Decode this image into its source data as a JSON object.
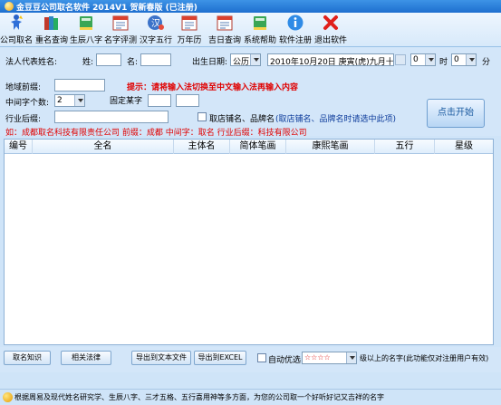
{
  "window": {
    "title": "金豆豆公司取名软件 2014V1 贺新春版 (已注册)"
  },
  "toolbar": [
    {
      "label": "公司取名",
      "icon": "figure-icon"
    },
    {
      "label": "重名查询",
      "icon": "books-icon"
    },
    {
      "label": "生辰八字",
      "icon": "book-icon"
    },
    {
      "label": "名字评测",
      "icon": "calendar-icon"
    },
    {
      "label": "汉字五行",
      "icon": "character-icon"
    },
    {
      "label": "万年历",
      "icon": "calendar-icon"
    },
    {
      "label": "吉日查询",
      "icon": "calendar-icon"
    },
    {
      "label": "系统帮助",
      "icon": "book-icon"
    },
    {
      "label": "软件注册",
      "icon": "info-icon"
    },
    {
      "label": "退出软件",
      "icon": "close-icon"
    }
  ],
  "form": {
    "legal_rep_label": "法人代表姓名:",
    "surname_label": "姓:",
    "name_label": "名:",
    "birth_label": "出生日期:",
    "calendar_type": "公历",
    "birth_date": "2010年10月20日 庚寅(虎)九月十三",
    "hour_value": "0",
    "hour_label": "时",
    "minute_value": "0",
    "minute_label": "分",
    "region_label": "地域前缀:",
    "hint": "提示：请将输入法切换至中文输入法再输入内容",
    "mid_count_label": "中间字个数:",
    "mid_count_value": "2",
    "fixed_char_label": "固定某字",
    "industry_label": "行业后缀:",
    "shop_option": "取店铺名、品牌名",
    "shop_option_note": "(取店铺名、品牌名时请选中此项)",
    "example": "如：成都取名科技有限责任公司  前缀：成都  中间字：取名  行业后缀：科技有限公司",
    "start_button": "点击开始"
  },
  "table": {
    "columns": [
      "编号",
      "全名",
      "主体名",
      "简体笔画",
      "康熙笔画",
      "五行",
      "星级"
    ]
  },
  "bottom": {
    "naming_knowledge": "取名知识",
    "related_law": "相关法律",
    "export_txt": "导出到文本文件",
    "export_excel": "导出到EXCEL",
    "auto_pick_label": "自动优选",
    "star_value": "☆☆☆☆",
    "star_note": "级以上的名字(此功能仅对注册用户有效)"
  },
  "status": {
    "text": "根据周易及现代姓名研究学、生辰八字、三才五格、五行喜用神等多方面，为您的公司取一个好听好记又吉祥的名字"
  }
}
